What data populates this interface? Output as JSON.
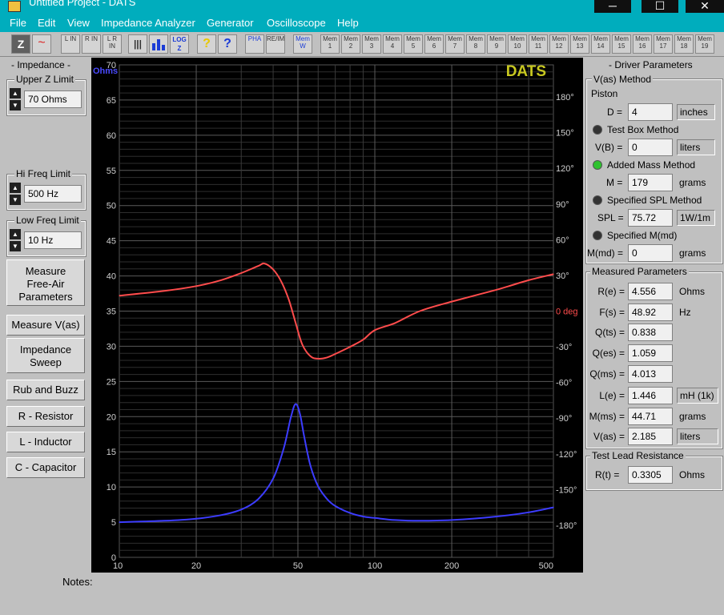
{
  "window": {
    "title": "Untitled Project - DATS",
    "minimize": "─",
    "maximize": "☐",
    "close": "✕"
  },
  "menu": [
    "File",
    "Edit",
    "View",
    "Impedance Analyzer",
    "Generator",
    "Oscilloscope",
    "Help"
  ],
  "toolbar": {
    "buttons": [
      "Z",
      "~",
      "L IN",
      "R IN",
      "L R IN",
      "|||",
      "bars",
      "LOG Z",
      "?",
      "?",
      "PHA",
      "RE/IM",
      "Mem W"
    ],
    "mem_label": "Mem",
    "mem_slots": [
      "1",
      "2",
      "3",
      "4",
      "5",
      "6",
      "7",
      "8",
      "9",
      "10",
      "11",
      "12",
      "13",
      "14",
      "15",
      "16",
      "17",
      "18",
      "19"
    ]
  },
  "left": {
    "impedance_header": "- Impedance -",
    "upper_z_label": "Upper Z Limit",
    "upper_z_value": "70 Ohms",
    "hi_freq_label": "Hi Freq Limit",
    "hi_freq_value": "500 Hz",
    "low_freq_label": "Low Freq Limit",
    "low_freq_value": "10 Hz",
    "measure_free_air": [
      "Measure",
      "Free-Air",
      "Parameters"
    ],
    "measure_vas": "Measure V(as)",
    "impedance_sweep": [
      "Impedance",
      "Sweep"
    ],
    "rub_buzz": "Rub and Buzz",
    "resistor": "R - Resistor",
    "inductor": "L - Inductor",
    "capacitor": "C - Capacitor",
    "notes_label": "Notes:"
  },
  "right": {
    "driver_header": "- Driver Parameters",
    "vas_method_label": "V(as) Method",
    "piston_label": "Piston",
    "d_label": "D =",
    "d_value": "4",
    "d_unit": "inches",
    "test_box_label": "Test Box Method",
    "vb_label": "V(B) =",
    "vb_value": "0",
    "vb_unit": "liters",
    "added_mass_label": "Added Mass Method",
    "m_label": "M =",
    "m_value": "179",
    "m_unit": "grams",
    "spl_method_label": "Specified SPL Method",
    "spl_label": "SPL =",
    "spl_value": "75.72",
    "spl_unit": "1W/1m",
    "mmd_method_label": "Specified M(md)",
    "mmd_label": "M(md) =",
    "mmd_value": "0",
    "mmd_unit": "grams",
    "measured_header": "Measured Parameters",
    "params": [
      {
        "label": "R(e) =",
        "value": "4.556",
        "unit": "Ohms",
        "boxed": false
      },
      {
        "label": "F(s) =",
        "value": "48.92",
        "unit": "Hz",
        "boxed": false
      },
      {
        "label": "Q(ts) =",
        "value": "0.838",
        "unit": "",
        "boxed": false
      },
      {
        "label": "Q(es) =",
        "value": "1.059",
        "unit": "",
        "boxed": false
      },
      {
        "label": "Q(ms) =",
        "value": "4.013",
        "unit": "",
        "boxed": false
      },
      {
        "label": "L(e) =",
        "value": "1.446",
        "unit": "mH (1k)",
        "boxed": true
      },
      {
        "label": "M(ms) =",
        "value": "44.71",
        "unit": "grams",
        "boxed": false
      },
      {
        "label": "V(as) =",
        "value": "2.185",
        "unit": "liters",
        "boxed": true
      }
    ],
    "lead_header": "Test Lead Resistance",
    "rt_label": "R(t) =",
    "rt_value": "0.3305",
    "rt_unit": "Ohms",
    "selected_method": "Added Mass Method",
    "radio_on_color": "#2ec22e"
  },
  "chart_data": {
    "type": "line",
    "watermark": "DATS",
    "y_left_unit": "Ohms",
    "x_scale": "log",
    "xlim": [
      10,
      500
    ],
    "x_ticks": [
      10,
      20,
      50,
      100,
      200,
      500
    ],
    "ylim": [
      0,
      70
    ],
    "y_ticks": [
      0,
      5,
      10,
      15,
      20,
      25,
      30,
      35,
      40,
      45,
      50,
      55,
      60,
      65,
      70
    ],
    "y_right_ticks": [
      "180°",
      "150°",
      "120°",
      "90°",
      "60°",
      "30°",
      "0 deg",
      "-30°",
      "-60°",
      "-90°",
      "-120°",
      "-150°",
      "-180°"
    ],
    "y_right_values": [
      180,
      150,
      120,
      90,
      60,
      30,
      0,
      -30,
      -60,
      -90,
      -120,
      -150,
      -180
    ],
    "y_right_lim": [
      -207,
      207
    ],
    "grid": true,
    "series": [
      {
        "color": "#3c3cff",
        "axis": "left",
        "x": [
          10,
          15,
          20,
          25,
          30,
          35,
          40,
          44,
          47,
          49,
          51,
          53,
          56,
          60,
          65,
          70,
          80,
          90,
          100,
          120,
          150,
          200,
          300,
          400,
          500
        ],
        "y": [
          5.0,
          5.2,
          5.5,
          6.0,
          6.8,
          8.3,
          11.2,
          15.5,
          20.0,
          21.8,
          20.3,
          17.0,
          13.0,
          10.1,
          8.3,
          7.3,
          6.3,
          5.8,
          5.6,
          5.3,
          5.2,
          5.3,
          5.8,
          6.4,
          7.1
        ]
      },
      {
        "color": "#ff4c4c",
        "axis": "right",
        "x": [
          10,
          15,
          20,
          25,
          30,
          35,
          37,
          40,
          43,
          46,
          49,
          52,
          56,
          60,
          65,
          70,
          80,
          90,
          100,
          120,
          150,
          200,
          300,
          400,
          500
        ],
        "y": [
          13,
          17,
          21,
          26,
          32,
          38,
          40,
          35,
          25,
          10,
          -10,
          -28,
          -38,
          -40,
          -39,
          -36,
          -30,
          -24,
          -16,
          -10,
          0,
          8,
          18,
          26,
          31
        ]
      }
    ]
  }
}
